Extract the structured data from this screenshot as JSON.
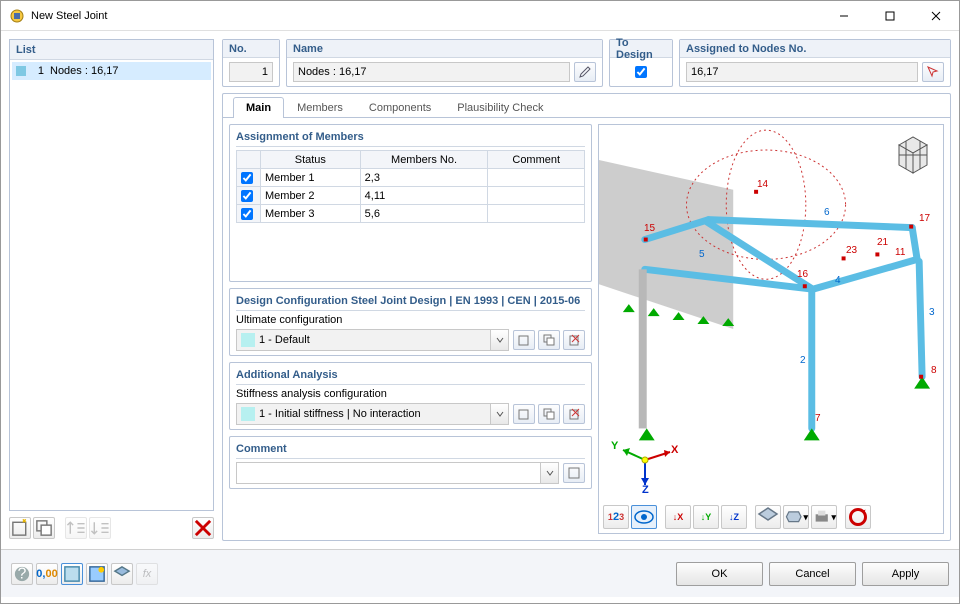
{
  "window": {
    "title": "New Steel Joint"
  },
  "tree": {
    "header": "List",
    "item_num": "1",
    "item_text": "Nodes : 16,17"
  },
  "hdr": {
    "no_label": "No.",
    "no_value": "1",
    "name_label": "Name",
    "name_value": "Nodes : 16,17",
    "todesign_label": "To Design",
    "assigned_label": "Assigned to Nodes No.",
    "assigned_value": "16,17"
  },
  "tabs": [
    "Main",
    "Members",
    "Components",
    "Plausibility Check"
  ],
  "assignment": {
    "title": "Assignment of Members",
    "cols": [
      "Status",
      "Members No.",
      "Comment"
    ],
    "rows": [
      {
        "label": "Member 1",
        "members": "2,3",
        "comment": ""
      },
      {
        "label": "Member 2",
        "members": "4,11",
        "comment": ""
      },
      {
        "label": "Member 3",
        "members": "5,6",
        "comment": ""
      }
    ]
  },
  "designconf": {
    "title": "Design Configuration  Steel Joint Design | EN 1993 | CEN | 2015-06",
    "label": "Ultimate configuration",
    "value": "1 - Default"
  },
  "addanalysis": {
    "title": "Additional Analysis",
    "label": "Stiffness analysis configuration",
    "value": "1 - Initial stiffness | No interaction"
  },
  "comment": {
    "title": "Comment"
  },
  "viewer": {
    "axes": {
      "x": "X",
      "y": "Y",
      "z": "Z"
    },
    "nodes": [
      "14",
      "17",
      "15",
      "21",
      "11",
      "23",
      "5",
      "6",
      "16",
      "4",
      "3",
      "2",
      "8",
      "7"
    ]
  },
  "footer": {
    "ok": "OK",
    "cancel": "Cancel",
    "apply": "Apply"
  }
}
